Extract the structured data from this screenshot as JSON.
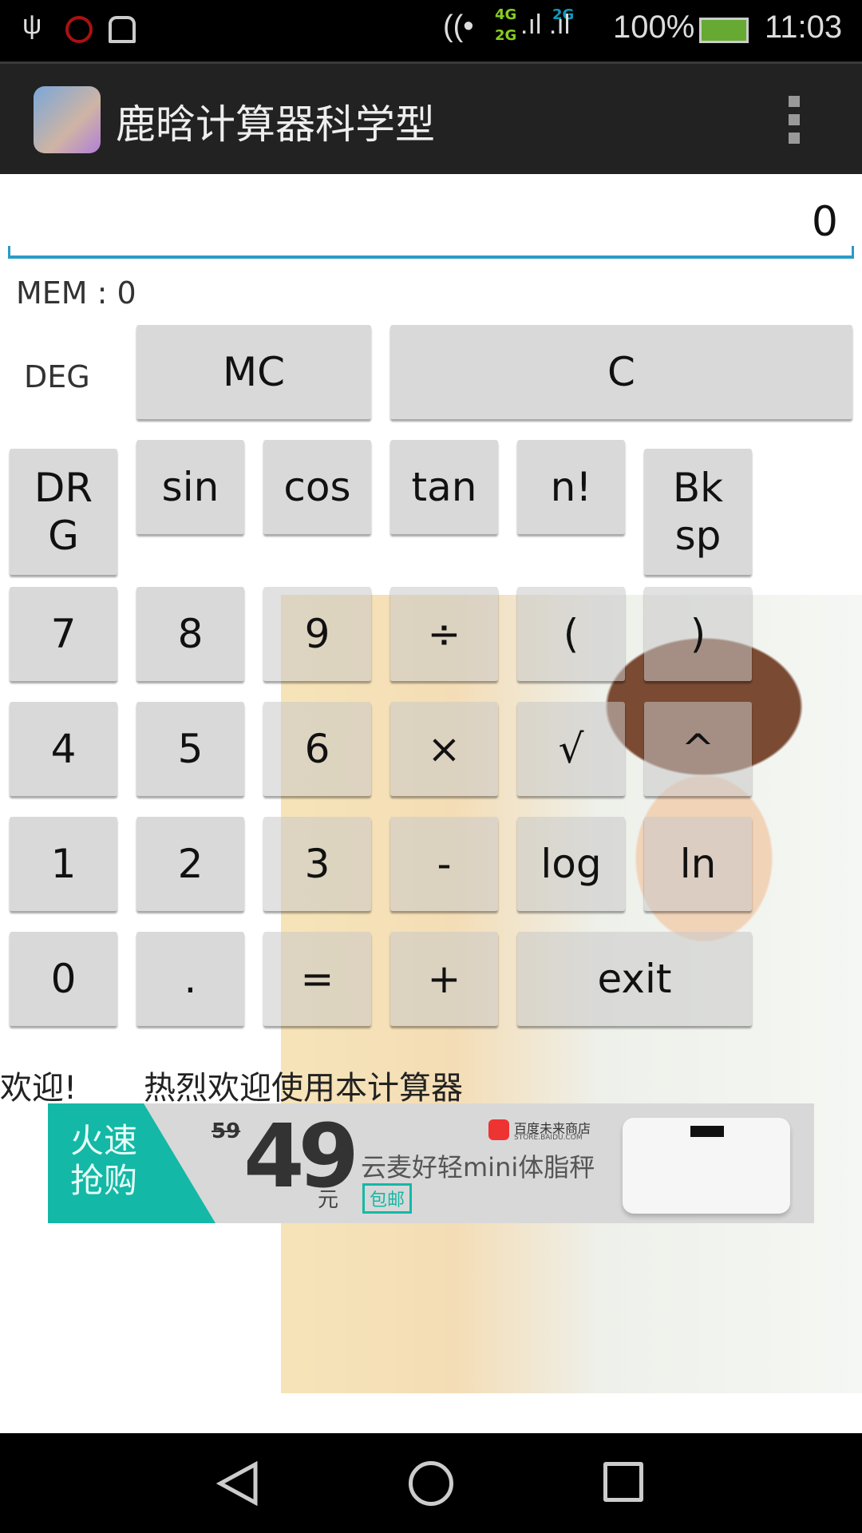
{
  "status_bar": {
    "net1_top": "4G",
    "net1_bottom": "2G",
    "net2": "2G",
    "battery": "100%",
    "time": "11:03",
    "icons": [
      "usb-icon",
      "alarm-icon",
      "android-debug-icon",
      "wifi-icon",
      "signal-icon",
      "battery-charging-icon"
    ]
  },
  "app_bar": {
    "title": "鹿晗计算器科学型",
    "overflow_icon": "more-vert-icon"
  },
  "display": {
    "value": "0"
  },
  "memory": {
    "label": "MEM : ",
    "value": "0"
  },
  "mode": "DEG",
  "buttons": {
    "mc": "MC",
    "c": "C",
    "drg": "DR G",
    "sin": "sin",
    "cos": "cos",
    "tan": "tan",
    "fact": "n!",
    "bksp": "Bk sp",
    "b7": "7",
    "b8": "8",
    "b9": "9",
    "div": "÷",
    "lp": "(",
    "rp": ")",
    "b4": "4",
    "b5": "5",
    "b6": "6",
    "mul": "×",
    "sqrt": "√",
    "pow": "^",
    "b1": "1",
    "b2": "2",
    "b3": "3",
    "sub": "-",
    "log": "log",
    "ln": "ln",
    "b0": "0",
    "dot": ".",
    "eq": "=",
    "add": "+",
    "exit": "exit"
  },
  "welcome": {
    "left": "欢迎!",
    "right": "热烈欢迎使用本计算器"
  },
  "ad": {
    "tag": "火速抢购",
    "old_price": "59",
    "price": "49",
    "unit": "元",
    "store": "百度未来商店",
    "store_url_text": "STORE.BAIDU.COM",
    "product": "云麦好轻mini体脂秤",
    "shipping": "包邮"
  },
  "accent": "#2a9cc6"
}
